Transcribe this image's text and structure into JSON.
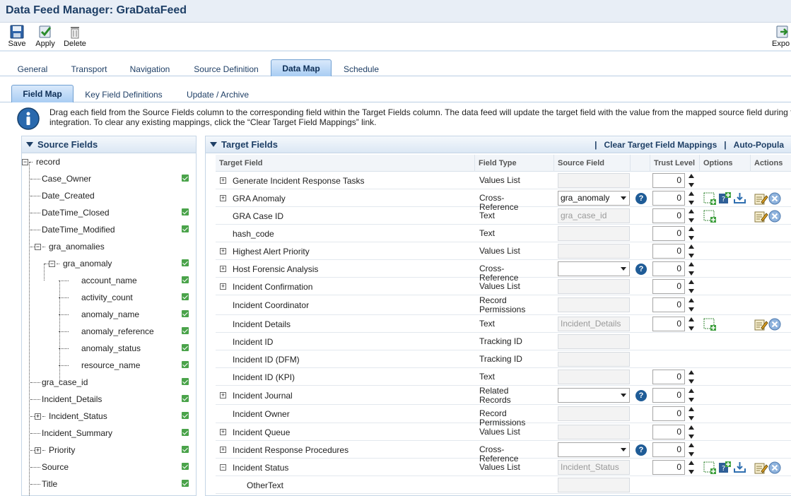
{
  "window": {
    "title": "Data Feed Manager: GraDataFeed"
  },
  "toolbar": {
    "save": "Save",
    "apply": "Apply",
    "delete": "Delete",
    "export": "Expo"
  },
  "main_tabs": [
    "General",
    "Transport",
    "Navigation",
    "Source Definition",
    "Data Map",
    "Schedule"
  ],
  "sub_tabs": [
    "Field Map",
    "Key Field Definitions",
    "Update / Archive"
  ],
  "info": {
    "line1": "Drag each field from the Source Fields column to the corresponding field within the Target Fields column. The data feed will update the target field with the value from the mapped source field during f",
    "line2": "integration. To clear any existing mappings, click the “Clear Target Field Mappings” link."
  },
  "source_panel": {
    "title": "Source Fields",
    "items": [
      {
        "label": "record"
      },
      {
        "label": "Case_Owner"
      },
      {
        "label": "Date_Created"
      },
      {
        "label": "DateTime_Closed"
      },
      {
        "label": "DateTime_Modified"
      },
      {
        "label": "gra_anomalies"
      },
      {
        "label": "gra_anomaly"
      },
      {
        "label": "account_name"
      },
      {
        "label": "activity_count"
      },
      {
        "label": "anomaly_name"
      },
      {
        "label": "anomaly_reference"
      },
      {
        "label": "anomaly_status"
      },
      {
        "label": "resource_name"
      },
      {
        "label": "gra_case_id"
      },
      {
        "label": "Incident_Details"
      },
      {
        "label": "Incident_Status"
      },
      {
        "label": "Incident_Summary"
      },
      {
        "label": "Priority"
      },
      {
        "label": "Source"
      },
      {
        "label": "Title"
      }
    ]
  },
  "target_panel": {
    "title": "Target Fields",
    "clear_link": "Clear Target Field Mappings",
    "auto_link": "Auto-Popula",
    "separator": "|",
    "columns": [
      "Target Field",
      "Field Type",
      "Source Field",
      "Trust Level",
      "Options",
      "Actions"
    ],
    "rows": [
      {
        "name": "Generate Incident Response Tasks",
        "type": "Values List",
        "source": "",
        "trust": "0"
      },
      {
        "name": "GRA Anomaly",
        "type": "Cross-Reference",
        "source": "gra_anomaly",
        "trust": "0"
      },
      {
        "name": "GRA Case ID",
        "type": "Text",
        "source": "gra_case_id",
        "trust": "0"
      },
      {
        "name": "hash_code",
        "type": "Text",
        "source": "",
        "trust": "0"
      },
      {
        "name": "Highest Alert Priority",
        "type": "Values List",
        "source": "",
        "trust": "0"
      },
      {
        "name": "Host Forensic Analysis",
        "type": "Cross-Reference",
        "source": "",
        "trust": "0"
      },
      {
        "name": "Incident Confirmation",
        "type": "Values List",
        "source": "",
        "trust": "0"
      },
      {
        "name": "Incident Coordinator",
        "type": "Record Permissions",
        "source": "",
        "trust": "0"
      },
      {
        "name": "Incident Details",
        "type": "Text",
        "source": "Incident_Details",
        "trust": "0"
      },
      {
        "name": "Incident ID",
        "type": "Tracking ID",
        "source": "",
        "trust": ""
      },
      {
        "name": "Incident ID (DFM)",
        "type": "Tracking ID",
        "source": "",
        "trust": ""
      },
      {
        "name": "Incident ID (KPI)",
        "type": "Text",
        "source": "",
        "trust": "0"
      },
      {
        "name": "Incident Journal",
        "type": "Related Records",
        "source": "",
        "trust": "0"
      },
      {
        "name": "Incident Owner",
        "type": "Record Permissions",
        "source": "",
        "trust": "0"
      },
      {
        "name": "Incident Queue",
        "type": "Values List",
        "source": "",
        "trust": "0"
      },
      {
        "name": "Incident Response Procedures",
        "type": "Cross-Reference",
        "source": "",
        "trust": "0"
      },
      {
        "name": "Incident Status",
        "type": "Values List",
        "source": "Incident_Status",
        "trust": "0"
      },
      {
        "name": "OtherText",
        "type": "",
        "source": "",
        "trust": ""
      }
    ]
  },
  "colors": {
    "accent": "#1e3f66",
    "tab_active": "#a9cdf3",
    "check": "#4aa34a",
    "help": "#1f5c97"
  }
}
